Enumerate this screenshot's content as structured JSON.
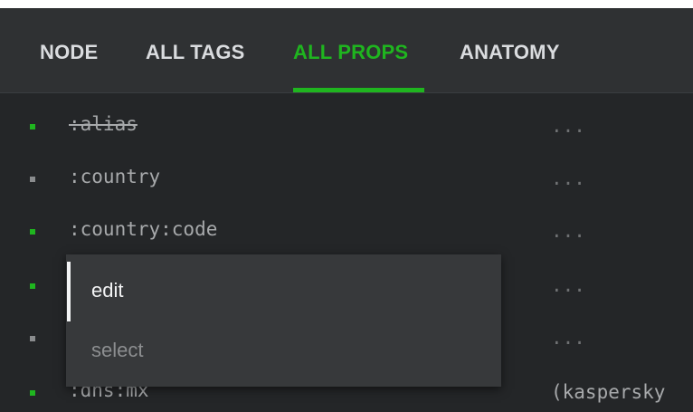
{
  "tabs": [
    {
      "label": "NODE"
    },
    {
      "label": "ALL TAGS"
    },
    {
      "label": "ALL PROPS"
    },
    {
      "label": "ANATOMY"
    }
  ],
  "props": [
    {
      "name": ":alias",
      "value": "...",
      "bullet": "green",
      "struck": true
    },
    {
      "name": ":country",
      "value": "...",
      "bullet": "gray",
      "struck": false
    },
    {
      "name": ":country:code",
      "value": "...",
      "bullet": "green",
      "struck": false
    },
    {
      "name": "",
      "value": "...",
      "bullet": "green",
      "struck": false
    },
    {
      "name": "",
      "value": "...",
      "bullet": "gray",
      "struck": false
    },
    {
      "name": ":dns:mx",
      "value": "(kaspersky",
      "bullet": "green",
      "struck": false
    }
  ],
  "context_menu": {
    "items": [
      {
        "label": "edit"
      },
      {
        "label": "select"
      }
    ]
  },
  "colors": {
    "accent": "#1fb51f",
    "background": "#242628",
    "tabbar": "#2f3133",
    "menu": "#37393b"
  }
}
